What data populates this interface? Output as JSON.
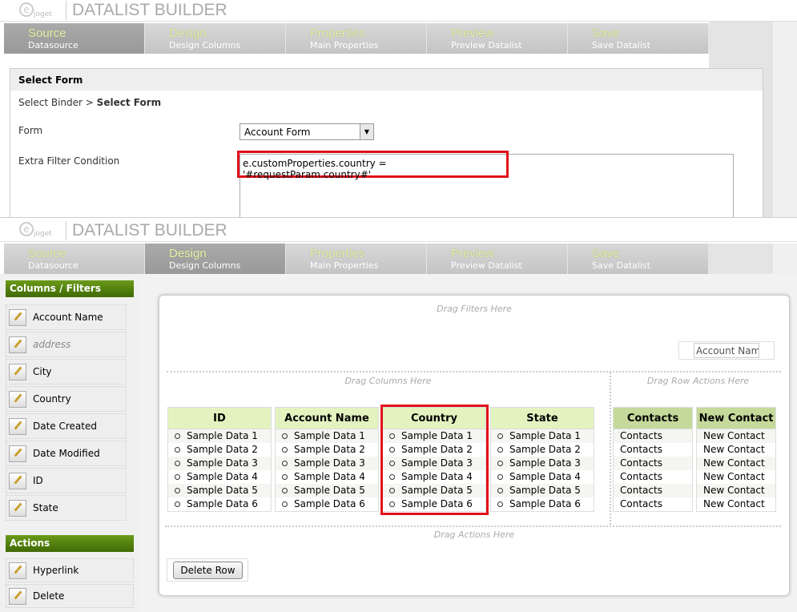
{
  "app": {
    "logo_text": "joget",
    "title": "DATALIST BUILDER"
  },
  "steps": [
    {
      "title": "Source",
      "subtitle": "Datasource"
    },
    {
      "title": "Design",
      "subtitle": "Design Columns"
    },
    {
      "title": "Properties",
      "subtitle": "Main Properties"
    },
    {
      "title": "Preview",
      "subtitle": "Preview Datalist"
    },
    {
      "title": "Save",
      "subtitle": "Save Datalist"
    }
  ],
  "source": {
    "header": "Select Form",
    "breadcrumb_parent": "Select Binder",
    "breadcrumb_sep": ">",
    "breadcrumb_current": "Select Form",
    "form_label": "Form",
    "form_value": "Account Form",
    "filter_label": "Extra Filter Condition",
    "filter_value": "e.customProperties.country = '#requestParam.country#'"
  },
  "sidebar": {
    "columns_header": "Columns / Filters",
    "columns": [
      "Account Name",
      "address",
      "City",
      "Country",
      "Date Created",
      "Date Modified",
      "ID",
      "State"
    ],
    "actions_header": "Actions",
    "actions": [
      "Hyperlink",
      "Delete"
    ]
  },
  "design": {
    "drag_filters": "Drag Filters Here",
    "filter_placeholder": "Account Name",
    "drag_columns": "Drag Columns Here",
    "drag_row_actions": "Drag Row Actions Here",
    "drag_actions": "Drag Actions Here",
    "columns": [
      {
        "header": "ID",
        "rows": [
          "Sample Data 1",
          "Sample Data 2",
          "Sample Data 3",
          "Sample Data 4",
          "Sample Data 5",
          "Sample Data 6"
        ]
      },
      {
        "header": "Account Name",
        "rows": [
          "Sample Data 1",
          "Sample Data 2",
          "Sample Data 3",
          "Sample Data 4",
          "Sample Data 5",
          "Sample Data 6"
        ]
      },
      {
        "header": "Country",
        "rows": [
          "Sample Data 1",
          "Sample Data 2",
          "Sample Data 3",
          "Sample Data 4",
          "Sample Data 5",
          "Sample Data 6"
        ]
      },
      {
        "header": "State",
        "rows": [
          "Sample Data 1",
          "Sample Data 2",
          "Sample Data 3",
          "Sample Data 4",
          "Sample Data 5",
          "Sample Data 6"
        ]
      }
    ],
    "row_actions": [
      {
        "header": "Contacts",
        "rows": [
          "Contacts",
          "Contacts",
          "Contacts",
          "Contacts",
          "Contacts",
          "Contacts"
        ]
      },
      {
        "header": "New Contact",
        "rows": [
          "New Contact",
          "New Contact",
          "New Contact",
          "New Contact",
          "New Contact",
          "New Contact"
        ]
      }
    ],
    "delete_row_button": "Delete Row"
  }
}
